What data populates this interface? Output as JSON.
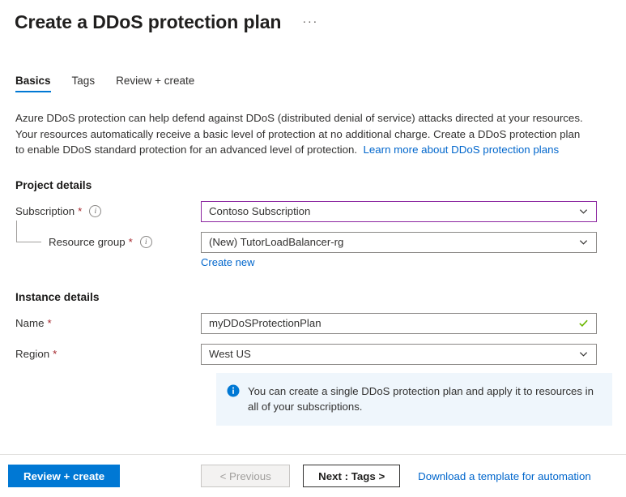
{
  "header": {
    "title": "Create a DDoS protection plan",
    "more_label": "···"
  },
  "tabs": [
    {
      "label": "Basics",
      "active": true
    },
    {
      "label": "Tags",
      "active": false
    },
    {
      "label": "Review + create",
      "active": false
    }
  ],
  "description": {
    "text": "Azure DDoS protection can help defend against DDoS (distributed denial of service) attacks directed at your resources. Your resources automatically receive a basic level of protection at no additional charge. Create a DDoS protection plan to enable DDoS standard protection for an advanced level of protection.",
    "link_label": "Learn more about DDoS protection plans"
  },
  "project_details": {
    "heading": "Project details",
    "subscription": {
      "label": "Subscription",
      "required": "*",
      "value": "Contoso Subscription",
      "icon": "chevron-down-icon",
      "info_icon": "info-circle-icon",
      "focused": true
    },
    "resource_group": {
      "label": "Resource group",
      "required": "*",
      "value": "(New) TutorLoadBalancer-rg",
      "icon": "chevron-down-icon",
      "info_icon": "info-circle-icon",
      "create_new_label": "Create new"
    }
  },
  "instance_details": {
    "heading": "Instance details",
    "name": {
      "label": "Name",
      "required": "*",
      "value": "myDDoSProtectionPlan",
      "icon": "checkmark-icon"
    },
    "region": {
      "label": "Region",
      "required": "*",
      "value": "West US",
      "icon": "chevron-down-icon"
    }
  },
  "info_banner": {
    "icon": "info-filled-icon",
    "text": "You can create a single DDoS protection plan and apply it to resources in all of your subscriptions."
  },
  "footer": {
    "review_create_label": "Review + create",
    "previous_label": "< Previous",
    "next_label": "Next : Tags >",
    "download_template_label": "Download a template for automation"
  },
  "colors": {
    "accent": "#0078d4",
    "link": "#0066cc",
    "required": "#a4262c",
    "focus_border": "#8c26a0",
    "valid": "#6bb700",
    "banner_bg": "#eff6fc"
  }
}
